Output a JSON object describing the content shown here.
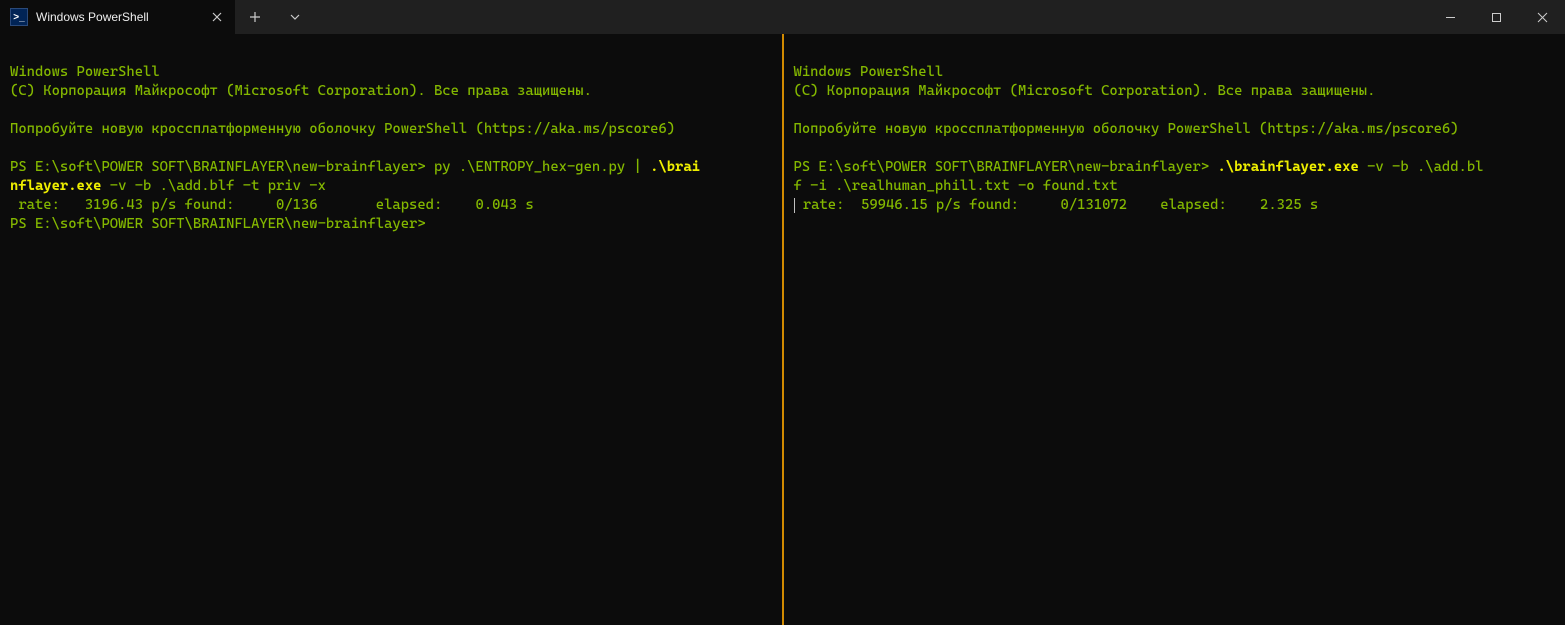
{
  "window": {
    "tab_title": "Windows PowerShell",
    "new_tab_label": "+",
    "dropdown_label": "⌄",
    "minimize_label": "—",
    "maximize_label": "☐",
    "close_label": "✕"
  },
  "icon": {
    "ps_glyph": ">_"
  },
  "left_pane": {
    "banner_line1": "Windows PowerShell",
    "banner_line2": "(C) Корпорация Майкрософт (Microsoft Corporation). Все права защищены.",
    "banner_line3": "Попробуйте новую кроссплатформенную оболочку PowerShell (https://aka.ms/pscore6)",
    "prompt_prefix": "PS E:\\soft\\POWER SOFT\\BRAINFLAYER\\new-brainflayer> ",
    "cmd_part1": "py .\\ENTROPY_hex-gen.py | ",
    "cmd_bold1": ".\\brai",
    "cmd_bold2": "nflayer.exe",
    "cmd_part2": " -v -b .\\add.blf -t priv -x",
    "stat_line": " rate:   3196.43 p/s found:     0/136       elapsed:    0.043 s",
    "prompt2": "PS E:\\soft\\POWER SOFT\\BRAINFLAYER\\new-brainflayer>"
  },
  "right_pane": {
    "banner_line1": "Windows PowerShell",
    "banner_line2": "(C) Корпорация Майкрософт (Microsoft Corporation). Все права защищены.",
    "banner_line3": "Попробуйте новую кроссплатформенную оболочку PowerShell (https://aka.ms/pscore6)",
    "prompt_prefix": "PS E:\\soft\\POWER SOFT\\BRAINFLAYER\\new-brainflayer> ",
    "cmd_bold1": ".\\brainflayer.exe",
    "cmd_part1a": " -v -b .\\add.bl",
    "cmd_part1b": "f -i .\\realhuman_phill.txt -o found.txt",
    "stat_line": " rate:  59946.15 p/s found:     0/131072    elapsed:    2.325 s"
  }
}
